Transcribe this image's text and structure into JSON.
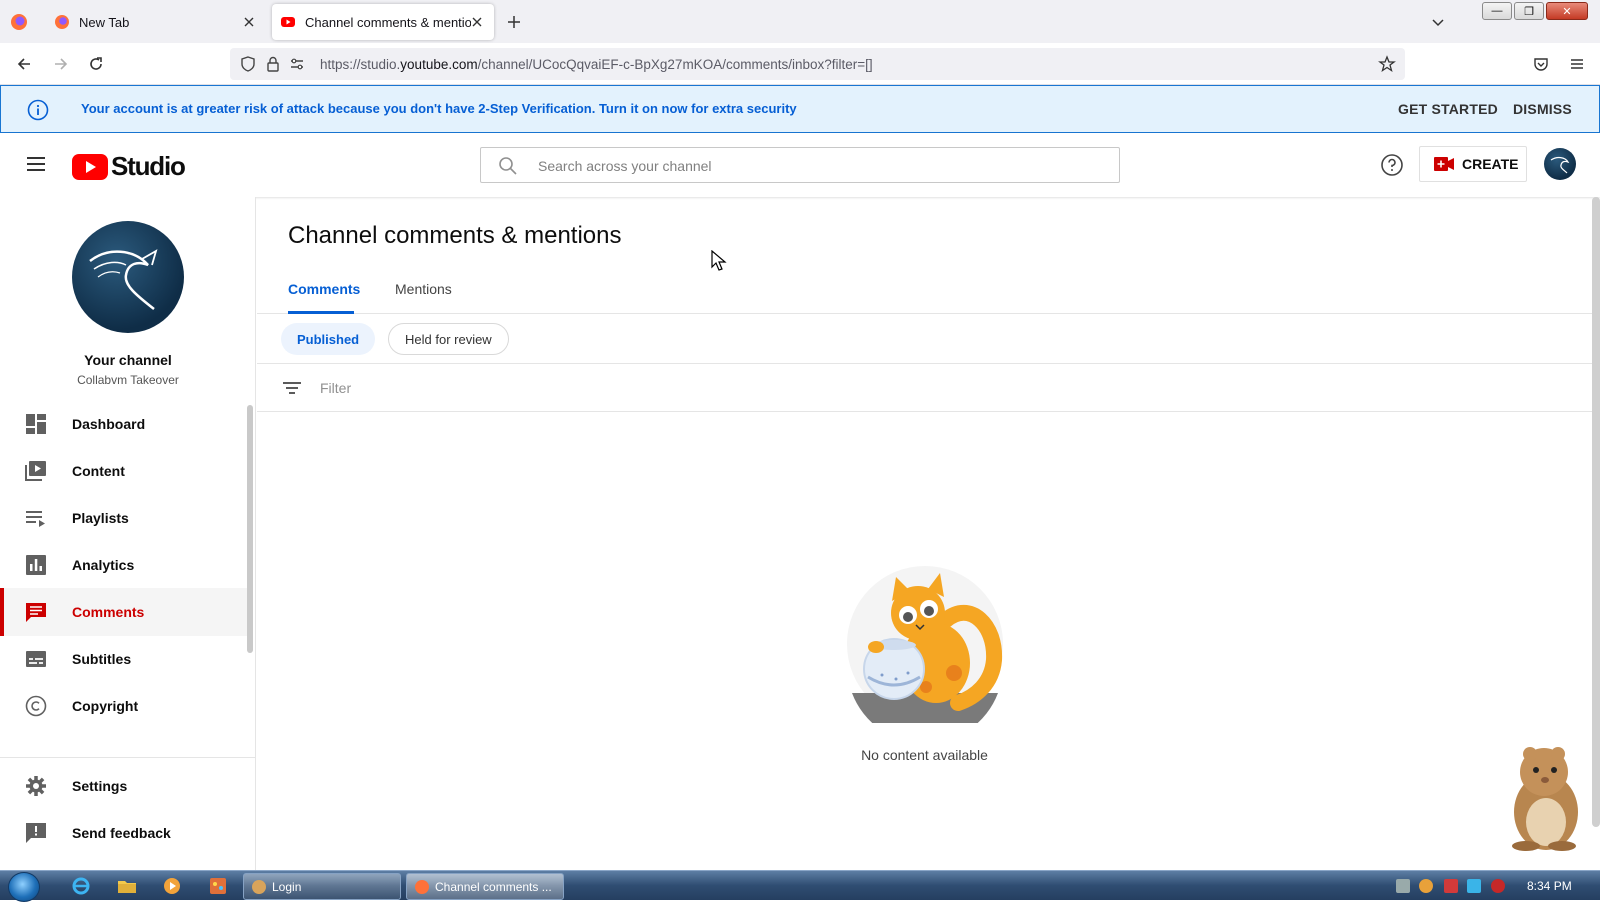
{
  "browser": {
    "tabs": [
      {
        "title": "New Tab"
      },
      {
        "title": "Channel comments & mentions"
      }
    ],
    "url_prefix": "https://studio.",
    "url_host": "youtube.com",
    "url_path": "/channel/UCocQqvaiEF-c-BpXg27mKOA/comments/inbox?filter=[]"
  },
  "banner": {
    "message": "Your account is at greater risk of attack because you don't have 2-Step Verification. Turn it on now for extra security",
    "get_started": "GET STARTED",
    "dismiss": "DISMISS"
  },
  "header": {
    "logo_text": "Studio",
    "search_placeholder": "Search across your channel",
    "create_label": "CREATE"
  },
  "sidebar": {
    "your_channel": "Your channel",
    "channel_name": "Collabvm Takeover",
    "items": [
      {
        "label": "Dashboard",
        "icon": "dashboard-icon"
      },
      {
        "label": "Content",
        "icon": "content-icon"
      },
      {
        "label": "Playlists",
        "icon": "playlists-icon"
      },
      {
        "label": "Analytics",
        "icon": "analytics-icon"
      },
      {
        "label": "Comments",
        "icon": "comments-icon",
        "selected": true
      },
      {
        "label": "Subtitles",
        "icon": "subtitles-icon"
      },
      {
        "label": "Copyright",
        "icon": "copyright-icon"
      }
    ],
    "bottom_items": [
      {
        "label": "Settings",
        "icon": "gear-icon"
      },
      {
        "label": "Send feedback",
        "icon": "feedback-icon"
      }
    ]
  },
  "main": {
    "title": "Channel comments & mentions",
    "tabs": [
      {
        "label": "Comments",
        "active": true
      },
      {
        "label": "Mentions"
      }
    ],
    "chips": [
      {
        "label": "Published",
        "selected": true
      },
      {
        "label": "Held for review"
      }
    ],
    "filter_placeholder": "Filter",
    "empty_message": "No content available"
  },
  "taskbar": {
    "tasks": [
      {
        "label": "Login"
      },
      {
        "label": "Channel comments ..."
      }
    ],
    "clock": "8:34 PM"
  },
  "colors": {
    "accent_blue": "#065fd4",
    "youtube_red": "#ff0000",
    "selected_red": "#cc0000",
    "banner_bg": "#e3f2fd"
  }
}
